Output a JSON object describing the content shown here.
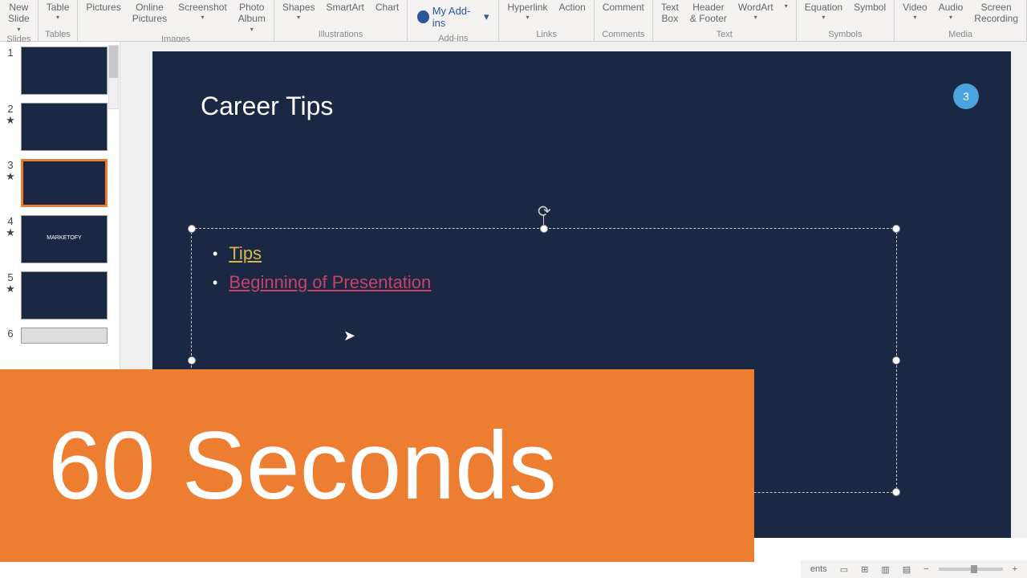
{
  "ribbon": {
    "groups": [
      {
        "label": "Slides",
        "items": [
          {
            "t": "New\nSlide",
            "drop": true
          }
        ]
      },
      {
        "label": "Tables",
        "items": [
          {
            "t": "Table",
            "drop": true
          }
        ]
      },
      {
        "label": "Images",
        "items": [
          {
            "t": "Pictures"
          },
          {
            "t": "Online\nPictures"
          },
          {
            "t": "Screenshot",
            "drop": true
          },
          {
            "t": "Photo\nAlbum",
            "drop": true
          }
        ]
      },
      {
        "label": "Illustrations",
        "items": [
          {
            "t": "Shapes",
            "drop": true
          },
          {
            "t": "SmartArt"
          },
          {
            "t": "Chart"
          }
        ]
      },
      {
        "label": "Add-ins",
        "addins": true,
        "text": "My Add-ins",
        "dropSide": true
      },
      {
        "label": "Links",
        "items": [
          {
            "t": "Hyperlink",
            "drop": true
          },
          {
            "t": "Action"
          }
        ]
      },
      {
        "label": "Comments",
        "items": [
          {
            "t": "Comment"
          }
        ]
      },
      {
        "label": "Text",
        "items": [
          {
            "t": "Text\nBox"
          },
          {
            "t": "Header\n& Footer"
          },
          {
            "t": "WordArt",
            "drop": true
          },
          {
            "t": " ",
            "drop": true
          }
        ]
      },
      {
        "label": "Symbols",
        "items": [
          {
            "t": "Equation",
            "drop": true
          },
          {
            "t": "Symbol"
          }
        ]
      },
      {
        "label": "Media",
        "items": [
          {
            "t": "Video",
            "drop": true
          },
          {
            "t": "Audio",
            "drop": true
          },
          {
            "t": "Screen\nRecording"
          }
        ]
      }
    ]
  },
  "thumbnails": [
    {
      "num": "1",
      "star": false,
      "selected": false
    },
    {
      "num": "2",
      "star": true,
      "selected": false
    },
    {
      "num": "3",
      "star": true,
      "selected": true
    },
    {
      "num": "4",
      "star": true,
      "selected": false,
      "label": "MARKETOFY"
    },
    {
      "num": "5",
      "star": true,
      "selected": false
    },
    {
      "num": "6",
      "star": false,
      "selected": false,
      "partial": true
    }
  ],
  "slide": {
    "title": "Career Tips",
    "badge": "3",
    "bullets": {
      "tips": "Tips",
      "beginning": "Beginning of Presentation"
    }
  },
  "overlay": {
    "text": "60 Seconds"
  },
  "status": {
    "ents": "ents",
    "minus": "−",
    "plus": "+"
  }
}
